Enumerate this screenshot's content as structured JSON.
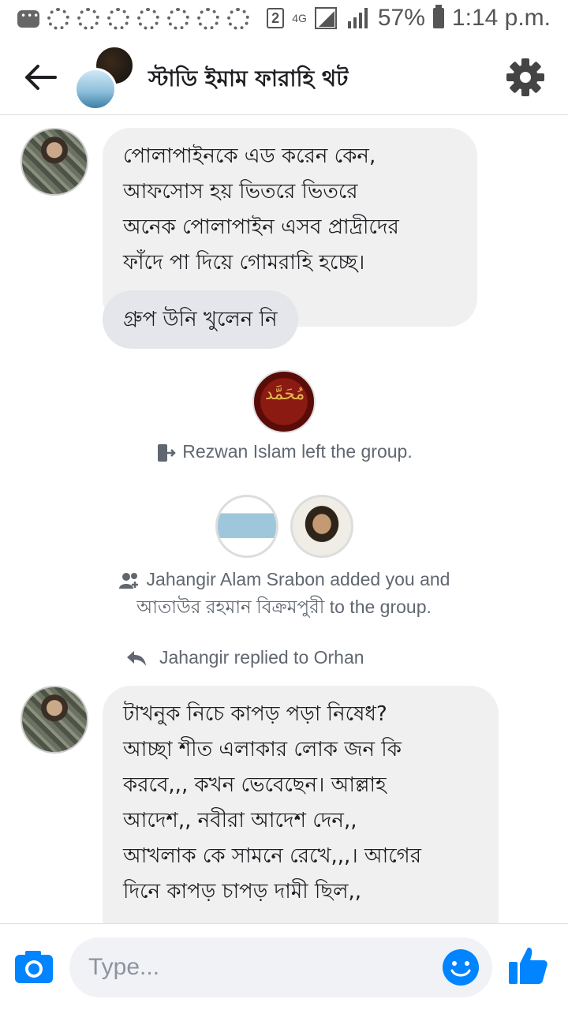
{
  "status_bar": {
    "sim_slot": "2",
    "network": "4G",
    "battery": "57%",
    "time": "1:14 p.m."
  },
  "header": {
    "title": "স্টাডি ইমাম ফারাহি থট",
    "back_icon": "arrow-left-icon",
    "settings_icon": "gear-icon"
  },
  "messages": {
    "msg1_lines": [
      "পোলাপাইনকে এড করেন কেন,",
      "আফসোস  হয় ভিতরে ভিতরে",
      "অনেক পোলাপাইন এসব প্রাদ্রীদের",
      "ফাঁদে পা দিয়ে গোমরাহি হচ্ছে।"
    ],
    "msg2": "গ্রুপ উনি খুলেন নি",
    "left_notice": "Rezwan Islam left the group.",
    "added_notice_line1": "Jahangir Alam Srabon added you and",
    "added_notice_line2": "আতাউর রহমান বিক্রমপুরী to the group.",
    "reply_label": "Jahangir replied to Orhan",
    "msg3_lines": [
      "টাখনুক নিচে কাপড়  পড়া নিষেধ?",
      "আচ্ছা  শীত এলাকার লোক জন কি",
      "করবে,,,  কখন ভেবেছেন।  আল্লাহ",
      "আদেশ,, নবীরা আদেশ দেন,,",
      "আখলাক কে সামনে রেখে,,,। আগের",
      "দিনে কাপড় চাপড় দামী ছিল,,"
    ]
  },
  "composer": {
    "placeholder": "Type...",
    "camera_icon": "camera-icon",
    "emoji_icon": "smiley-icon",
    "like_icon": "thumbs-up-icon"
  },
  "colors": {
    "accent": "#0084ff",
    "bubble_bg": "#f1f0f0",
    "system_text": "#606770"
  }
}
